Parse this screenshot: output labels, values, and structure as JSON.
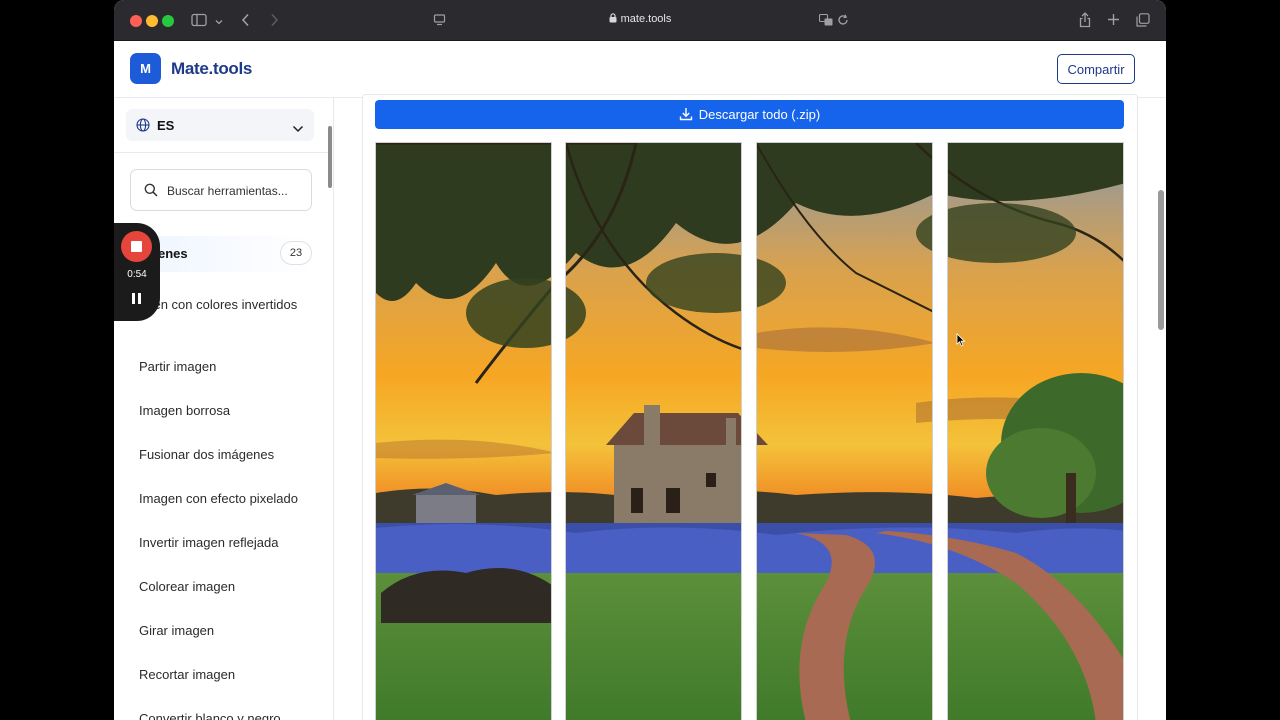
{
  "browser": {
    "url": "mate.tools"
  },
  "header": {
    "logo_letter": "M",
    "brand": "Mate.tools",
    "share_label": "Compartir"
  },
  "sidebar": {
    "language": "ES",
    "search_placeholder": "Buscar herramientas...",
    "category": {
      "label": "enes",
      "count": "23"
    },
    "items": [
      {
        "label": "agen con colores invertidos"
      },
      {
        "label": "Partir imagen"
      },
      {
        "label": "Imagen borrosa"
      },
      {
        "label": "Fusionar dos imágenes"
      },
      {
        "label": "Imagen con efecto pixelado"
      },
      {
        "label": "Invertir imagen reflejada"
      },
      {
        "label": "Colorear imagen"
      },
      {
        "label": "Girar imagen"
      },
      {
        "label": "Recortar imagen"
      },
      {
        "label": "Convertir blanco y negro"
      }
    ]
  },
  "recorder": {
    "time": "0:54"
  },
  "main": {
    "download_label": "Descargar todo (.zip)",
    "tiles": 4
  },
  "colors": {
    "brand": "#1e5bd8",
    "download": "#1764ec",
    "record": "#e5453a"
  }
}
